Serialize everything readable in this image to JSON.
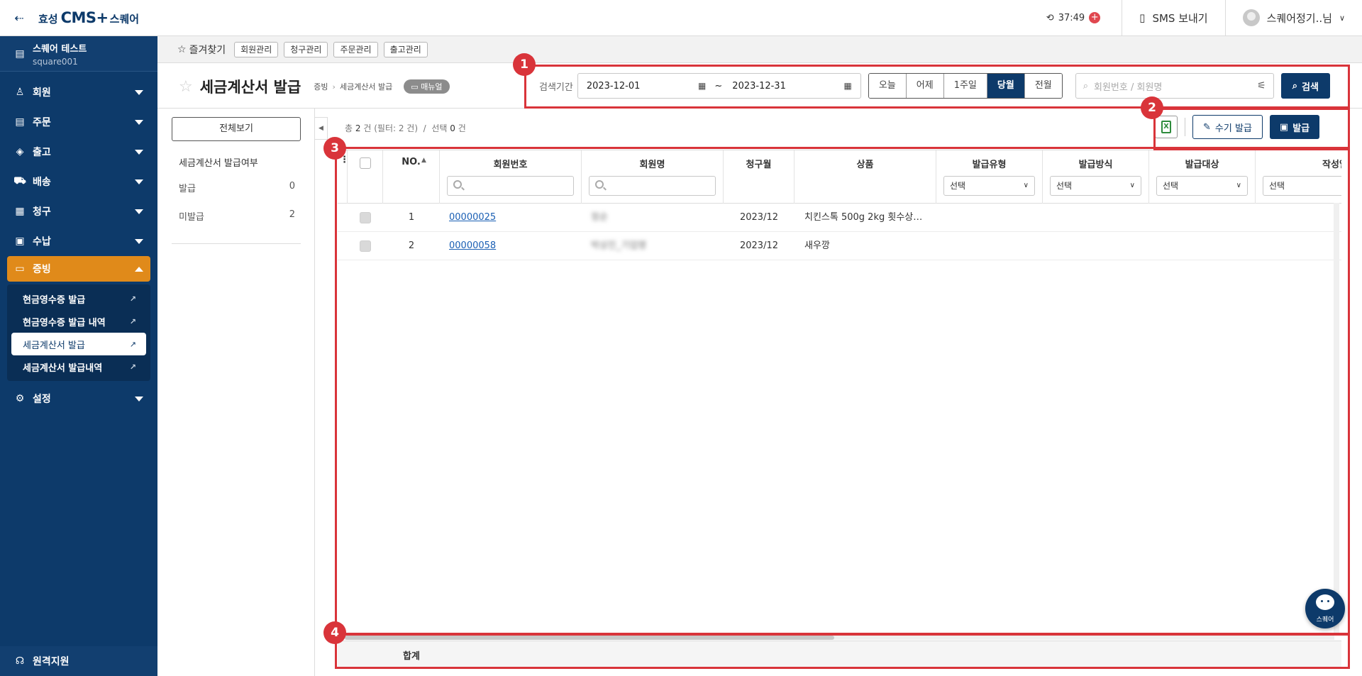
{
  "topbar": {
    "logo": {
      "part1": "효성",
      "part2": "CMS+",
      "part3": "스퀘어"
    },
    "timer": "37:49",
    "sms_label": "SMS 보내기",
    "user_label": "스퀘어정기..님"
  },
  "sidebar": {
    "account_name": "스퀘어 테스트",
    "account_id": "square001",
    "items": [
      {
        "label": "회원",
        "icon": "person-icon"
      },
      {
        "label": "주문",
        "icon": "clipboard-icon"
      },
      {
        "label": "출고",
        "icon": "box-icon"
      },
      {
        "label": "배송",
        "icon": "truck-icon"
      },
      {
        "label": "청구",
        "icon": "document-icon"
      },
      {
        "label": "수납",
        "icon": "register-icon"
      },
      {
        "label": "증빙",
        "icon": "archive-icon"
      },
      {
        "label": "설정",
        "icon": "gear-icon"
      }
    ],
    "submenu": [
      {
        "label": "현금영수증 발급"
      },
      {
        "label": "현금영수증 발급 내역"
      },
      {
        "label": "세금계산서 발급"
      },
      {
        "label": "세금계산서 발급내역"
      }
    ],
    "bottom_label": "원격지원"
  },
  "favbar": {
    "title": "즐겨찾기",
    "chips": [
      "회원관리",
      "청구관리",
      "주문관리",
      "출고관리"
    ]
  },
  "header": {
    "title": "세금계산서 발급",
    "breadcrumb": [
      "증빙",
      "세금계산서 발급"
    ],
    "manual_label": "매뉴얼",
    "search_period_label": "검색기간",
    "date_from": "2023-12-01",
    "date_tilde": "~",
    "date_to": "2023-12-31",
    "period_buttons": [
      "오늘",
      "어제",
      "1주일",
      "당월",
      "전월"
    ],
    "active_period": "당월",
    "member_search_placeholder": "회원번호 / 회원명",
    "search_button": "검색"
  },
  "filter_panel": {
    "all_button": "전체보기",
    "section_title": "세금계산서 발급여부",
    "rows": [
      {
        "label": "발급",
        "count": "0"
      },
      {
        "label": "미발급",
        "count": "2"
      }
    ]
  },
  "summary": {
    "total_prefix": "총",
    "total": "2",
    "unit": "건",
    "filter_text": "(필터: 2 건)",
    "slash": "/",
    "selected_label": "선택",
    "selected": "0"
  },
  "actions": {
    "excel_label": "X",
    "manual_issue": "수기 발급",
    "issue": "발급"
  },
  "grid": {
    "columns": [
      "NO.",
      "회원번호",
      "회원명",
      "청구월",
      "상품",
      "발급유형",
      "발급방식",
      "발급대상",
      "작성일"
    ],
    "select_default": "선택",
    "rows": [
      {
        "no": "1",
        "member_no": "00000025",
        "member_name": "정순",
        "bill_month": "2023/12",
        "product": "치킨스톡 500g 2kg 횟수상…"
      },
      {
        "no": "2",
        "member_no": "00000058",
        "member_name": "박상진_기업명",
        "bill_month": "2023/12",
        "product": "새우깡"
      }
    ],
    "footer_label": "합계"
  },
  "callouts": [
    "1",
    "2",
    "3",
    "4"
  ],
  "chatbot_label": "스퀘어",
  "colors": {
    "brand_navy": "#0d3a6a",
    "accent_orange": "#e08a1a",
    "callout_red": "#d9343a"
  }
}
